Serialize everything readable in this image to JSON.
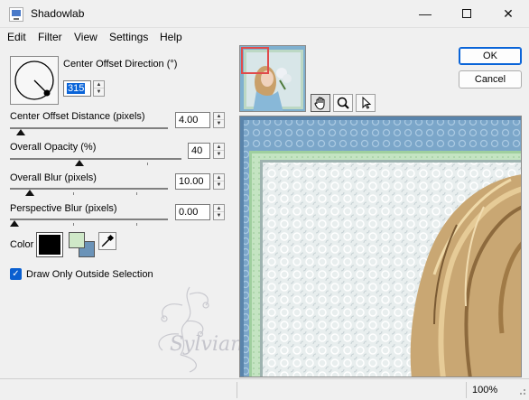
{
  "window": {
    "title": "Shadowlab",
    "minimize_glyph": "—",
    "close_glyph": "✕"
  },
  "menu": [
    "Edit",
    "Filter",
    "View",
    "Settings",
    "Help"
  ],
  "controls": {
    "direction_label": "Center Offset Direction (°)",
    "direction_value": "315",
    "distance_label": "Center Offset Distance (pixels)",
    "distance_value": "4.00",
    "opacity_label": "Overall Opacity (%)",
    "opacity_value": "40",
    "blur_label": "Overall Blur (pixels)",
    "blur_value": "10.00",
    "perspective_label": "Perspective Blur (pixels)",
    "perspective_value": "0.00",
    "color_label": "Color",
    "checkbox_label": "Draw Only Outside Selection",
    "checkbox_checked": true
  },
  "sliders": {
    "distance_fraction": 0.04,
    "opacity_fraction": 0.4,
    "blur_fraction": 0.1,
    "perspective_fraction": 0.0
  },
  "colors": {
    "shadow_color": "#000000",
    "fg_swatch": "#cfe8c8",
    "bg_swatch": "#6b93b8",
    "accent": "#0a64d8"
  },
  "buttons": {
    "ok": "OK",
    "cancel": "Cancel"
  },
  "tools": [
    "hand-icon",
    "zoom-icon",
    "pointer-icon"
  ],
  "watermark_text": "Sylviane",
  "status": {
    "zoom": "100%"
  }
}
